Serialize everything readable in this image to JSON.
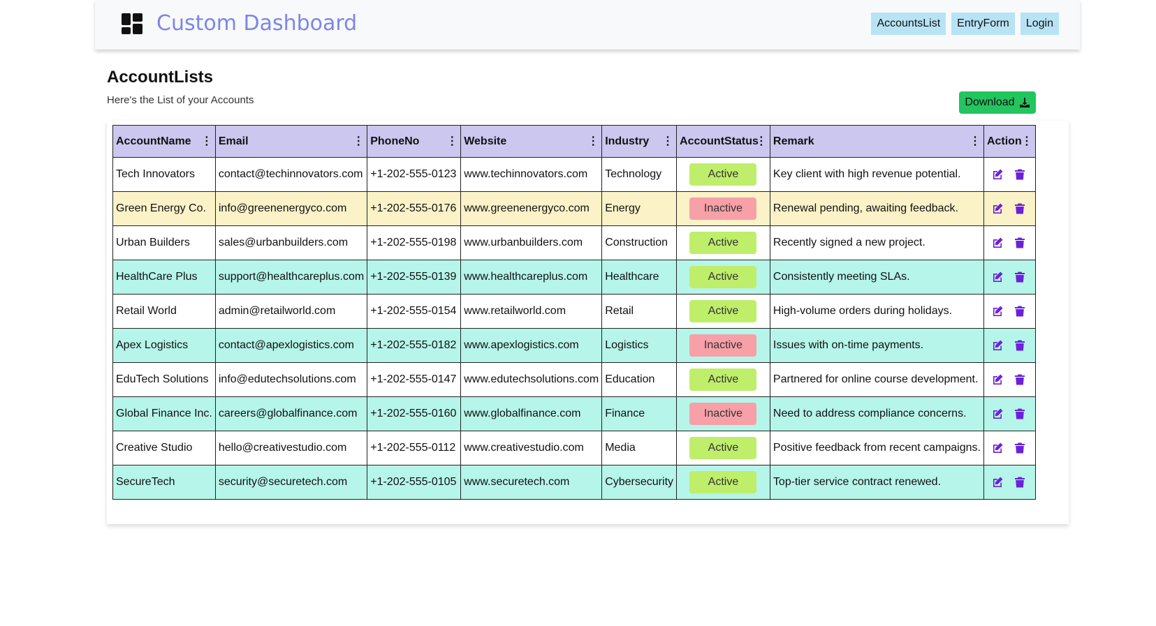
{
  "app": {
    "title": "Custom Dashboard"
  },
  "nav": [
    {
      "label": "AccountsList"
    },
    {
      "label": "EntryForm"
    },
    {
      "label": "Login"
    }
  ],
  "page": {
    "title": "AccountLists",
    "subtitle": "Here's the List of your Accounts",
    "download_label": "Download"
  },
  "table": {
    "columns": [
      "AccountName",
      "Email",
      "PhoneNo",
      "Website",
      "Industry",
      "AccountStatus",
      "Remark",
      "Action"
    ],
    "rows": [
      {
        "name": "Tech Innovators",
        "email": "contact@techinnovators.com",
        "phone": "+1-202-555-0123",
        "website": "www.techinnovators.com",
        "industry": "Technology",
        "status": "Active",
        "remark": "Key client with high revenue potential.",
        "row_color": "white"
      },
      {
        "name": "Green Energy Co.",
        "email": "info@greenenergyco.com",
        "phone": "+1-202-555-0176",
        "website": "www.greenenergyco.com",
        "industry": "Energy",
        "status": "Inactive",
        "remark": "Renewal pending, awaiting feedback.",
        "row_color": "yellow"
      },
      {
        "name": "Urban Builders",
        "email": "sales@urbanbuilders.com",
        "phone": "+1-202-555-0198",
        "website": "www.urbanbuilders.com",
        "industry": "Construction",
        "status": "Active",
        "remark": "Recently signed a new project.",
        "row_color": "white"
      },
      {
        "name": "HealthCare Plus",
        "email": "support@healthcareplus.com",
        "phone": "+1-202-555-0139",
        "website": "www.healthcareplus.com",
        "industry": "Healthcare",
        "status": "Active",
        "remark": "Consistently meeting SLAs.",
        "row_color": "cyan"
      },
      {
        "name": "Retail World",
        "email": "admin@retailworld.com",
        "phone": "+1-202-555-0154",
        "website": "www.retailworld.com",
        "industry": "Retail",
        "status": "Active",
        "remark": "High-volume orders during holidays.",
        "row_color": "white"
      },
      {
        "name": "Apex Logistics",
        "email": "contact@apexlogistics.com",
        "phone": "+1-202-555-0182",
        "website": "www.apexlogistics.com",
        "industry": "Logistics",
        "status": "Inactive",
        "remark": "Issues with on-time payments.",
        "row_color": "cyan"
      },
      {
        "name": "EduTech Solutions",
        "email": "info@edutechsolutions.com",
        "phone": "+1-202-555-0147",
        "website": "www.edutechsolutions.com",
        "industry": "Education",
        "status": "Active",
        "remark": "Partnered for online course development.",
        "row_color": "white"
      },
      {
        "name": "Global Finance Inc.",
        "email": "careers@globalfinance.com",
        "phone": "+1-202-555-0160",
        "website": "www.globalfinance.com",
        "industry": "Finance",
        "status": "Inactive",
        "remark": "Need to address compliance concerns.",
        "row_color": "cyan"
      },
      {
        "name": "Creative Studio",
        "email": "hello@creativestudio.com",
        "phone": "+1-202-555-0112",
        "website": "www.creativestudio.com",
        "industry": "Media",
        "status": "Active",
        "remark": "Positive feedback from recent campaigns.",
        "row_color": "white"
      },
      {
        "name": "SecureTech",
        "email": "security@securetech.com",
        "phone": "+1-202-555-0105",
        "website": "www.securetech.com",
        "industry": "Cybersecurity",
        "status": "Active",
        "remark": "Top-tier service contract renewed.",
        "row_color": "cyan"
      }
    ]
  },
  "icons": {
    "brand": "dashboard-icon",
    "download": "download-icon",
    "column_menu": "vertical-dots-icon",
    "edit": "edit-icon",
    "delete": "trash-icon"
  },
  "colors": {
    "brand_text": "#7d86e6",
    "nav_button": "#b7e3f5",
    "download_button": "#22c55e",
    "header_bg": "#cbc7ee",
    "active": "#bfee6b",
    "inactive": "#f7a0a8",
    "action_icon": "#6b21d9"
  }
}
